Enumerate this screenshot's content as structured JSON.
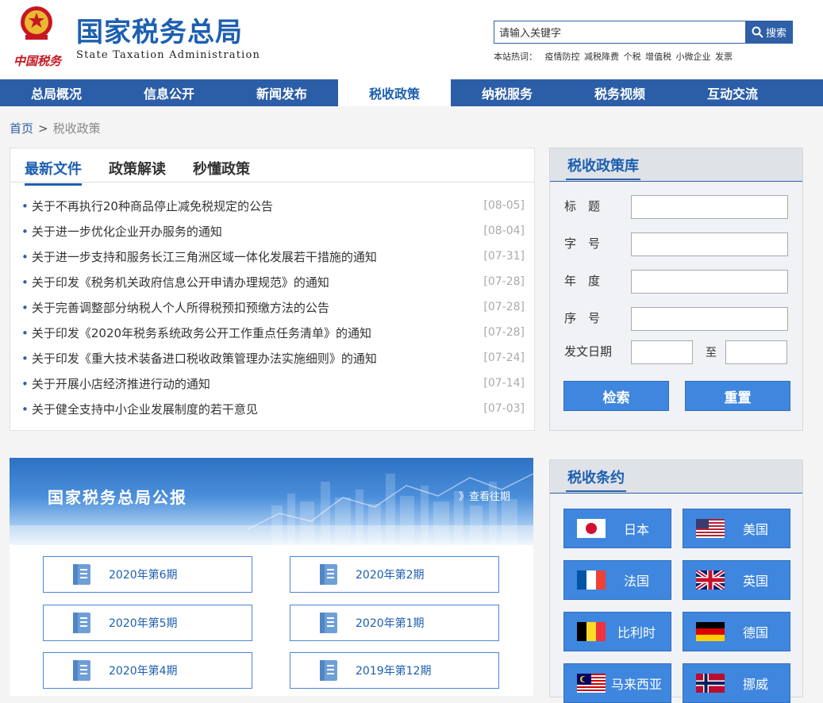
{
  "header": {
    "title": "国家税务总局",
    "subtitle": "State Taxation Administration",
    "brand": "中国税务",
    "search_placeholder": "请输入关键字",
    "search_label": "搜索",
    "hot_label": "本站热词：",
    "hot_words": [
      "疫情防控",
      "减税降费",
      "个税",
      "增值税",
      "小微企业",
      "发票"
    ]
  },
  "nav": [
    "总局概况",
    "信息公开",
    "新闻发布",
    "税收政策",
    "纳税服务",
    "税务视频",
    "互动交流"
  ],
  "nav_active": "税收政策",
  "breadcrumb": {
    "home": "首页",
    "sep": ">",
    "current": "税收政策"
  },
  "policy": {
    "tabs": [
      "最新文件",
      "政策解读",
      "秒懂政策"
    ],
    "items": [
      {
        "title": "关于不再执行20种商品停止减免税规定的公告",
        "date": "[08-05]"
      },
      {
        "title": "关于进一步优化企业开办服务的通知",
        "date": "[08-04]"
      },
      {
        "title": "关于进一步支持和服务长江三角洲区域一体化发展若干措施的通知",
        "date": "[07-31]"
      },
      {
        "title": "关于印发《税务机关政府信息公开申请办理规范》的通知",
        "date": "[07-28]"
      },
      {
        "title": "关于完善调整部分纳税人个人所得税预扣预缴方法的公告",
        "date": "[07-28]"
      },
      {
        "title": "关于印发《2020年税务系统政务公开工作重点任务清单》的通知",
        "date": "[07-28]"
      },
      {
        "title": "关于印发《重大技术装备进口税收政策管理办法实施细则》的通知",
        "date": "[07-24]"
      },
      {
        "title": "关于开展小店经济推进行动的通知",
        "date": "[07-14]"
      },
      {
        "title": "关于健全支持中小企业发展制度的若干意见",
        "date": "[07-03]"
      }
    ]
  },
  "library": {
    "title": "税收政策库",
    "labels": {
      "title": "标　题",
      "number": "字　号",
      "year": "年　度",
      "seq": "序　号",
      "date": "发文日期",
      "to": "至"
    },
    "search_btn": "检索",
    "reset_btn": "重置"
  },
  "gazette": {
    "title": "国家税务总局公报",
    "more": "》查看往期",
    "issues": [
      "2020年第6期",
      "2020年第2期",
      "2020年第5期",
      "2020年第1期",
      "2020年第4期",
      "2019年第12期"
    ]
  },
  "treaty": {
    "title": "税收条约",
    "countries": [
      "日本",
      "美国",
      "法国",
      "英国",
      "比利时",
      "德国",
      "马来西亚",
      "挪威"
    ]
  },
  "colors": {
    "primary": "#2c5ea8",
    "accent": "#3f86de",
    "title_blue": "#1d5fb0"
  }
}
